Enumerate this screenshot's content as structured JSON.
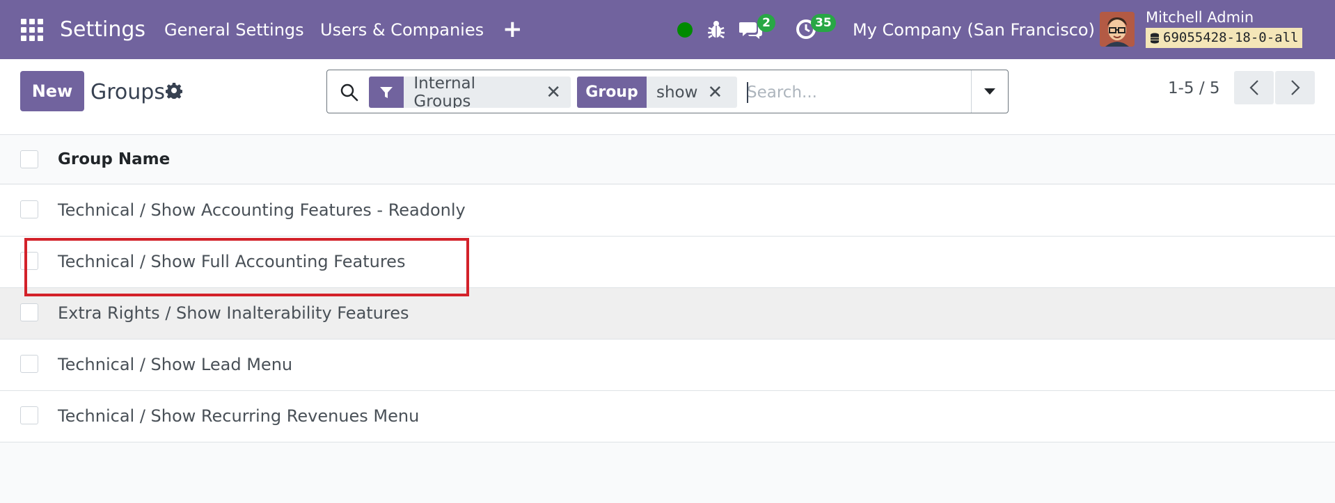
{
  "navbar": {
    "app_title": "Settings",
    "menus": [
      "General Settings",
      "Users & Companies"
    ],
    "messages_count": "2",
    "activities_count": "35",
    "company": "My Company (San Francisco)",
    "user_name": "Mitchell Admin",
    "database": "69055428-18-0-all"
  },
  "control_panel": {
    "new_label": "New",
    "title": "Groups",
    "search": {
      "facets": [
        {
          "label_icon": "filter-icon",
          "value": "Internal Groups"
        },
        {
          "label": "Group",
          "value": "show"
        }
      ],
      "placeholder": "Search..."
    },
    "pager": "1-5 / 5"
  },
  "list": {
    "column_header": "Group Name",
    "rows": [
      "Technical / Show Accounting Features - Readonly",
      "Technical / Show Full Accounting Features",
      "Extra Rights / Show Inalterability Features",
      "Technical / Show Lead Menu",
      "Technical / Show Recurring Revenues Menu"
    ]
  },
  "colors": {
    "brand": "#71639e",
    "badge": "#28a745",
    "highlight": "#d3222a"
  }
}
